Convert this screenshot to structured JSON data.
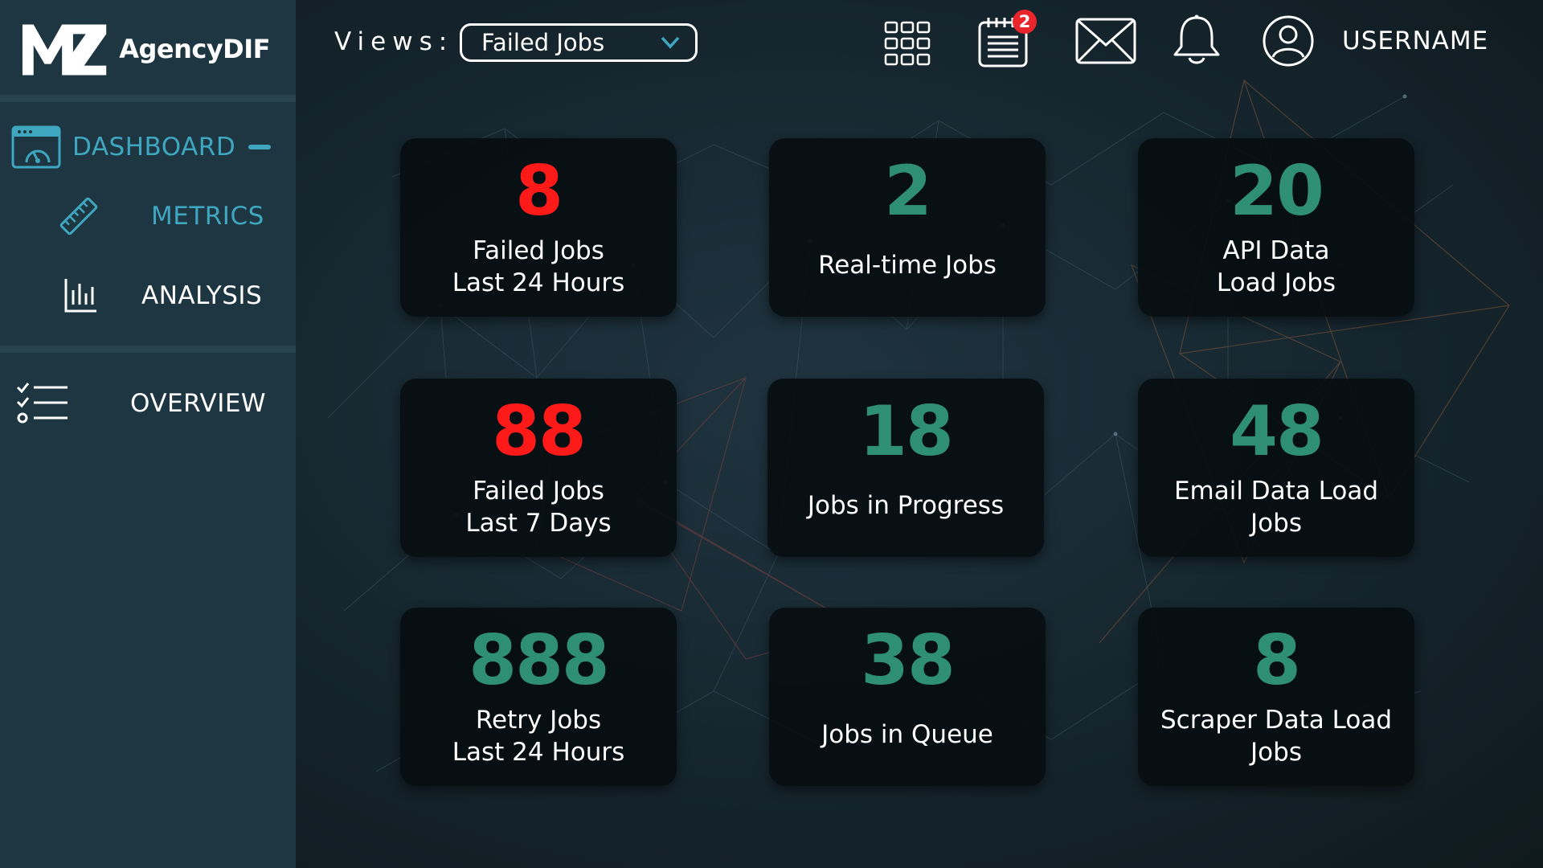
{
  "app": {
    "brand": "AgencyDIF",
    "logo_mark": "MZ",
    "colors": {
      "accent": "#3fa6c0",
      "alert": "#ff1a1a",
      "ok": "#2f8f74",
      "sidebar": "#1e3641"
    }
  },
  "sidebar": {
    "items": [
      {
        "label": "DASHBOARD",
        "icon": "dashboard-icon",
        "active": true
      },
      {
        "label": "METRICS",
        "icon": "ruler-icon"
      },
      {
        "label": "ANALYSIS",
        "icon": "bar-chart-icon"
      },
      {
        "label": "OVERVIEW",
        "icon": "checklist-icon"
      }
    ]
  },
  "header": {
    "views_label": "Views:",
    "views_value": "Failed Jobs",
    "icons": [
      "grid-icon",
      "calendar-icon",
      "mail-icon",
      "bell-icon",
      "user-icon"
    ],
    "calendar_badge": "2",
    "username": "USERNAME"
  },
  "cards": [
    {
      "value": "8",
      "label": "Failed Jobs\nLast 24 Hours",
      "status": "alert"
    },
    {
      "value": "2",
      "label": "Real-time Jobs",
      "status": "ok"
    },
    {
      "value": "20",
      "label": "API Data\nLoad Jobs",
      "status": "ok"
    },
    {
      "value": "88",
      "label": "Failed Jobs\nLast 7 Days",
      "status": "alert"
    },
    {
      "value": "18",
      "label": "Jobs in Progress",
      "status": "ok"
    },
    {
      "value": "48",
      "label": "Email Data Load\nJobs",
      "status": "ok"
    },
    {
      "value": "888",
      "label": "Retry Jobs\nLast 24 Hours",
      "status": "ok"
    },
    {
      "value": "38",
      "label": "Jobs in Queue",
      "status": "ok"
    },
    {
      "value": "8",
      "label": "Scraper Data Load\nJobs",
      "status": "ok"
    }
  ]
}
